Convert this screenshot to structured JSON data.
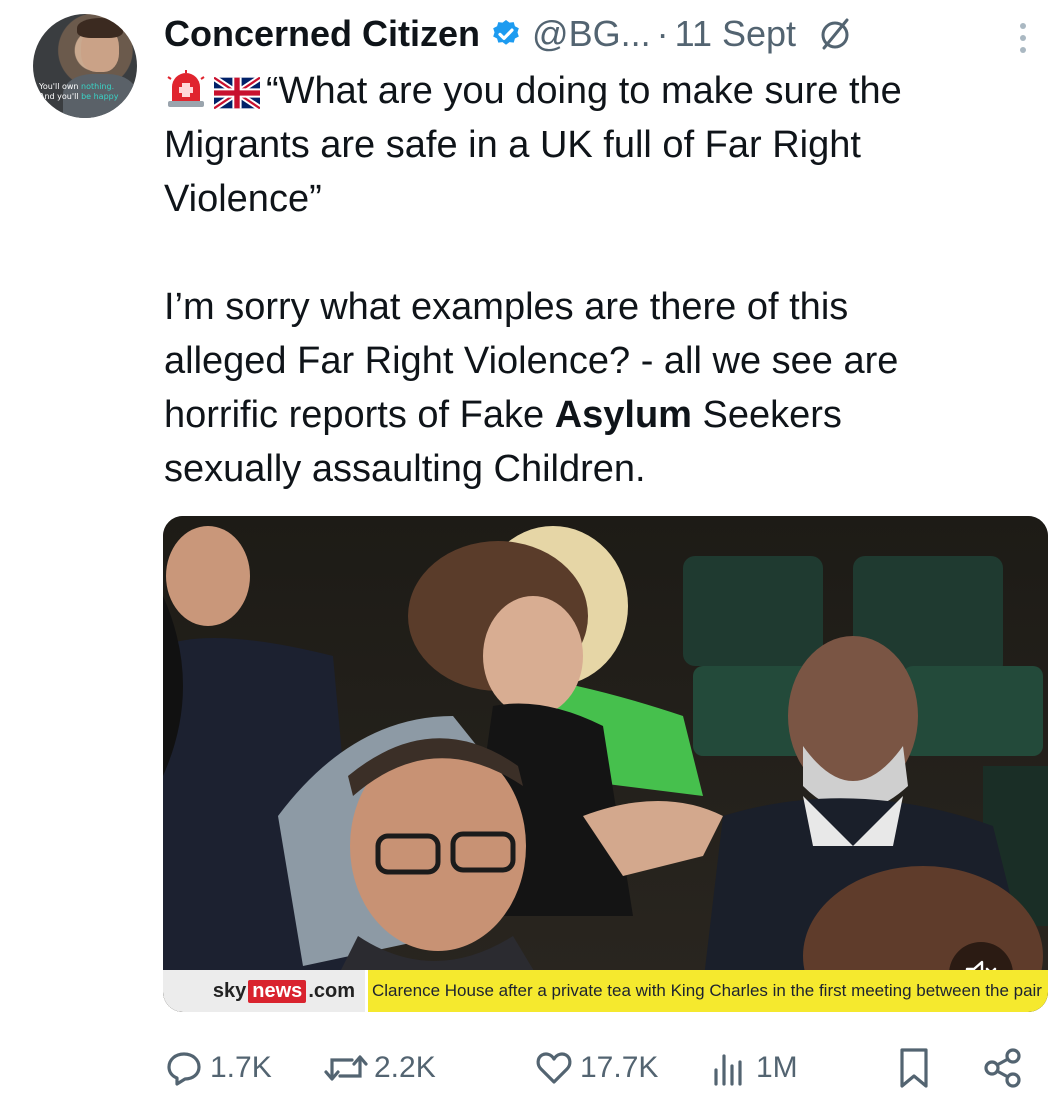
{
  "tweet": {
    "author_name": "Concerned Citizen",
    "handle": "@BG...",
    "separator": "·",
    "date": "11 Sept",
    "avatar_line1_a": "You'll own ",
    "avatar_line1_b": "nothing.",
    "avatar_line2_a": "And you'll ",
    "avatar_line2_b": "be happy",
    "line1": "“What are you doing to make sure the",
    "line2": "Migrants are safe in a UK full of Far Right",
    "line3": "Violence”",
    "line4": "I’m sorry what examples are there of this",
    "line5": "alleged Far Right Violence?  - all we see are",
    "line6_a": "horrific reports of Fake ",
    "line6_bold": "Asylum",
    "line6_b": " Seekers",
    "line7": "sexually assaulting Children."
  },
  "media": {
    "brand_sky": "sky",
    "brand_news": "news",
    "brand_com": ".com",
    "ticker_text": "Clarence House after a private tea with King Charles in the first meeting between the pair"
  },
  "actions": {
    "replies": "1.7K",
    "reposts": "2.2K",
    "likes": "17.7K",
    "views": "1M"
  },
  "colors": {
    "verified": "#1d9bf0",
    "muted_text": "#536471",
    "ticker_bg": "#f5e92e",
    "sky_red": "#d9232e"
  },
  "icons": [
    "verified-badge-icon",
    "grok-icon",
    "more-options-icon",
    "siren-icon",
    "uk-flag-icon",
    "mute-icon",
    "reply-icon",
    "repost-icon",
    "like-icon",
    "views-icon",
    "bookmark-icon",
    "share-icon"
  ]
}
